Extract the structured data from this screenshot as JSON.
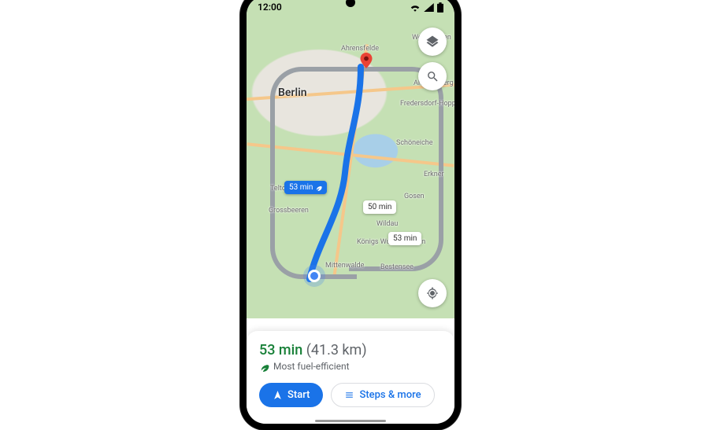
{
  "status": {
    "time": "12:00"
  },
  "map": {
    "city_label": "Berlin",
    "places": {
      "ahrensfelde": "Ahrensfelde",
      "werneuchen": "Werneuchen",
      "altlandsberg": "Altlandsberg",
      "hoppegarten": "Fredersdorf-Hoppegarten",
      "schoneiche": "Schöneiche",
      "erkner": "Erkner",
      "gosen": "Gosen",
      "konigs": "Königs Wusterhausen",
      "wildau": "Wildau",
      "bestensee": "Bestensee",
      "mittenwalde": "Mittenwalde",
      "grossbeeren": "Grossbeeren",
      "teltow": "Teltow"
    },
    "routes": {
      "primary_badge": "53 min",
      "alt1_badge": "50 min",
      "alt2_badge": "53 min"
    }
  },
  "sheet": {
    "duration": "53 min",
    "distance": "(41.3 km)",
    "eco_label": "Most fuel-efficient",
    "start_label": "Start",
    "steps_label": "Steps & more"
  }
}
